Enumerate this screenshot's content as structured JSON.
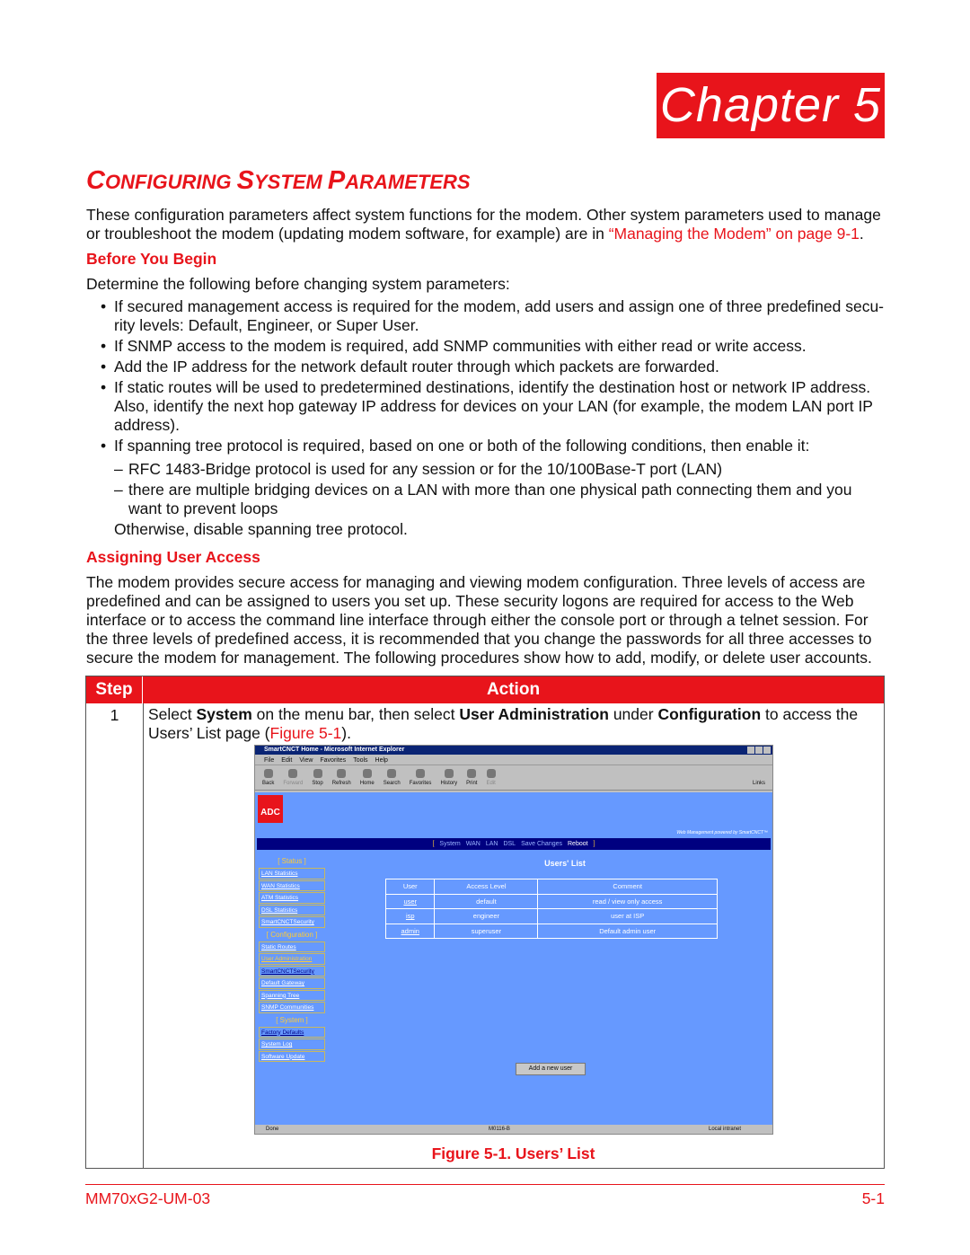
{
  "chapter": "Chapter  5",
  "title": {
    "c1": "C",
    "r1": "ONFIGURING ",
    "c2": "S",
    "r2": "YSTEM ",
    "c3": "P",
    "r3": "ARAMETERS"
  },
  "intro": {
    "text": "These configuration parameters affect system functions for the modem. Other system parameters used to manage or troubleshoot the modem (updating modem software, for example) are in ",
    "link": "“Managing the Modem” on page 9-1",
    "end": "."
  },
  "before": {
    "heading": "Before You Begin",
    "lead": "Determine the following before changing system parameters:",
    "bullets": [
      "If secured management access is required for the modem, add users and assign one of three predefined secu-rity levels: Default, Engineer, or Super User.",
      "If SNMP access to the modem is required, add SNMP communities with either read or write access.",
      "Add the IP address for the network default router through which packets are forwarded.",
      "If static routes will be used to predetermined destinations, identify the destination host or network IP address. Also, identify the next hop gateway IP address for devices on your LAN (for example, the modem LAN port IP address).",
      "If spanning tree protocol is required, based on one or both of the following conditions, then enable it:"
    ],
    "dashes": [
      "RFC 1483-Bridge protocol is used for any session or for the 10/100Base-T port (LAN)",
      "there are multiple bridging devices on a LAN with more than one physical path connecting them and you want to prevent loops"
    ],
    "otherwise": "Otherwise, disable spanning tree protocol."
  },
  "assign": {
    "heading": "Assigning User Access",
    "text": "The modem provides secure access for managing and viewing modem configuration. Three levels of access are predefined and can be assigned to users you set up. These security logons are required for access to the Web interface or to access the command line interface through either the console port or through a telnet session. For the three levels of predefined access, it is recommended that you change the passwords for all three accesses to secure the modem for management. The following procedures show how to add, modify, or delete user accounts."
  },
  "table": {
    "h_step": "Step",
    "h_action": "Action",
    "step": "1",
    "a1": "Select ",
    "b1": "System",
    "a2": " on the menu bar, then select ",
    "b2": "User Administration",
    "a3": " under ",
    "b3": "Configuration",
    "a4": " to access the Users’ List page (",
    "link": "Figure 5-1",
    "a5": ").",
    "caption": "Figure 5-1. Users’ List"
  },
  "browser": {
    "title": "SmartCNCT Home - Microsoft Internet Explorer",
    "menu": [
      "File",
      "Edit",
      "View",
      "Favorites",
      "Tools",
      "Help"
    ],
    "tools": [
      "Back",
      "Forward",
      "Stop",
      "Refresh",
      "Home",
      "Search",
      "Favorites",
      "History",
      "Print",
      "Edit"
    ],
    "links": "Links",
    "logo": "ADC",
    "powered": "Web Management powered by SmartCNCT™",
    "nav": [
      "System",
      "WAN",
      "LAN",
      "DSL",
      "Save Changes",
      "Reboot"
    ],
    "side": {
      "status": "[ Status ]",
      "status_items": [
        "LAN Statistics",
        "WAN Statistics",
        "ATM Statistics",
        "DSL Statistics",
        "SmartCNCTSecurity"
      ],
      "config": "[ Configuration ]",
      "config_items": [
        "Static Routes",
        "User Administration",
        "SmartCNCTSecurity",
        "Default Gateway",
        "Spanning Tree",
        "SNMP Communities"
      ],
      "system": "[ System ]",
      "system_items": [
        "Factory Defaults",
        "System Log",
        "Software Update"
      ]
    },
    "users_title": "Users' List",
    "cols": [
      "User",
      "Access Level",
      "Comment"
    ],
    "rows": [
      [
        "user",
        "default",
        "read / view only access"
      ],
      [
        "isp",
        "engineer",
        "user at ISP"
      ],
      [
        "admin",
        "superuser",
        "Default admin user"
      ]
    ],
    "add_button": "Add a new user",
    "status": {
      "left": "Done",
      "mid": "M0116-B",
      "right": "Local intranet"
    }
  },
  "footer": {
    "left": "MM70xG2-UM-03",
    "right": "5-1"
  },
  "colors": {
    "accent": "#e8141b",
    "page_bg": "#6699ff",
    "nav": "#000080"
  }
}
